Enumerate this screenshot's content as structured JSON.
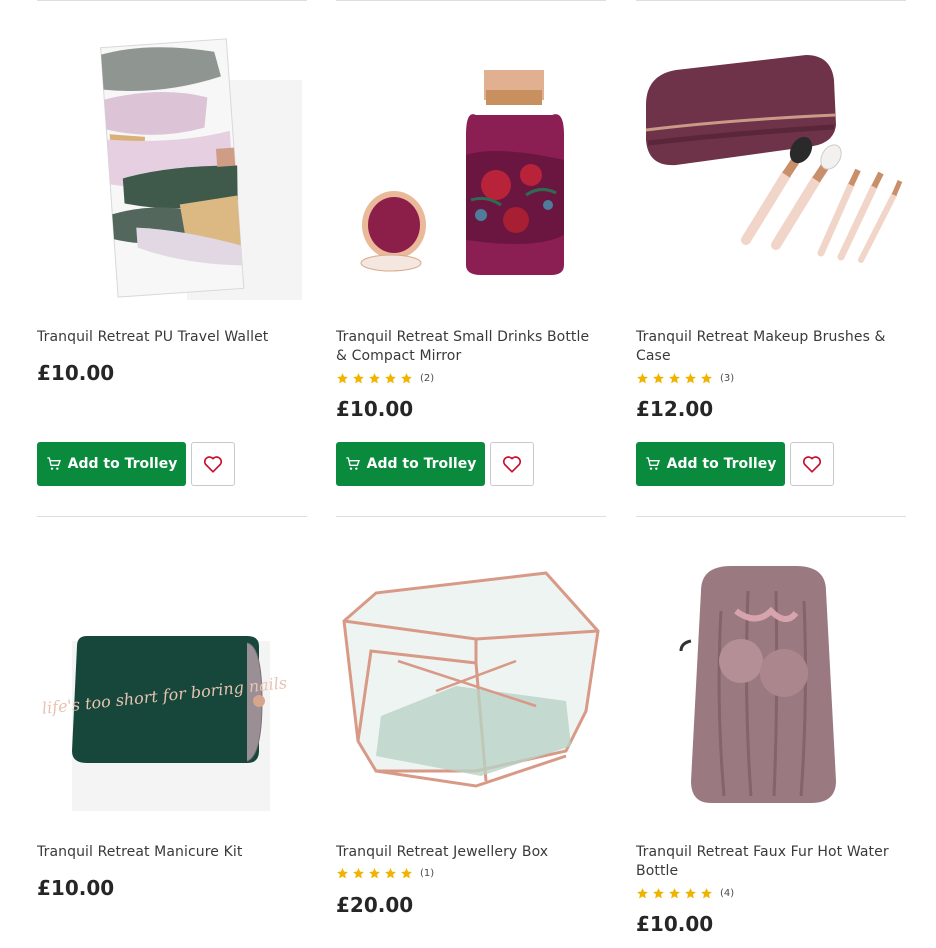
{
  "products": [
    {
      "name": "Tranquil Retreat PU Travel Wallet",
      "price": "£10.00",
      "stars": 0,
      "rating_count": "",
      "button": "Add to Trolley"
    },
    {
      "name": "Tranquil Retreat Small Drinks Bottle & Compact Mirror",
      "price": "£10.00",
      "stars": 5,
      "rating_count": "(2)",
      "button": "Add to Trolley"
    },
    {
      "name": "Tranquil Retreat Makeup Brushes & Case",
      "price": "£12.00",
      "stars": 5,
      "rating_count": "(3)",
      "button": "Add to Trolley"
    },
    {
      "name": "Tranquil Retreat Manicure Kit",
      "price": "£10.00",
      "stars": 0,
      "rating_count": ""
    },
    {
      "name": "Tranquil Retreat Jewellery Box",
      "price": "£20.00",
      "stars": 5,
      "rating_count": "(1)"
    },
    {
      "name": "Tranquil Retreat Faux Fur Hot Water Bottle",
      "price": "£10.00",
      "stars": 5,
      "rating_count": "(4)"
    }
  ],
  "product_images": [
    {
      "text": ""
    },
    {
      "text": ""
    },
    {
      "text": ""
    },
    {
      "text": "life's too short for boring nails"
    },
    {
      "text": ""
    },
    {
      "text": ""
    }
  ],
  "colors": {
    "button_green": "#0a8a3d",
    "star_yellow": "#f0b400",
    "heart_red": "#c8102e",
    "divider": "#dedede"
  },
  "icons": {
    "add_to_trolley": "cart-icon",
    "wishlist": "heart-icon",
    "rating": "star-icon"
  }
}
